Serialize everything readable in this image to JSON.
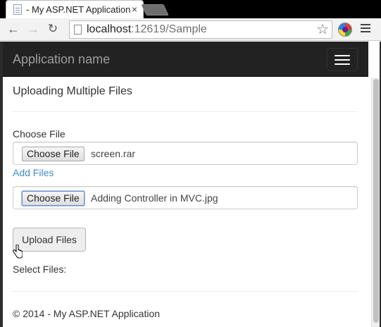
{
  "browser": {
    "tab_title": "- My ASP.NET Application",
    "tab_close": "×",
    "url_host": "localhost",
    "url_rest": ":12619/Sample",
    "icons": {
      "back": "arrow-left-icon",
      "forward": "arrow-right-icon",
      "reload": "reload-icon",
      "bookmark": "star-icon",
      "extension": "extension-icon",
      "menu": "hamburger-menu-icon"
    }
  },
  "navbar": {
    "brand": "Application name",
    "toggle_icon": "hamburger-menu-icon",
    "background": "#222222"
  },
  "page": {
    "title": "Uploading Multiple Files",
    "choose_label": "Choose File",
    "files": [
      {
        "button": "Choose File",
        "file_name": "screen.rar"
      },
      {
        "button": "Choose File",
        "file_name": "Adding Controller in MVC.jpg"
      }
    ],
    "add_files": "Add Files",
    "upload_button": "Upload Files",
    "select_files_label": "Select Files:",
    "footer": "© 2014 - My ASP.NET Application",
    "link_color": "#428bca"
  }
}
